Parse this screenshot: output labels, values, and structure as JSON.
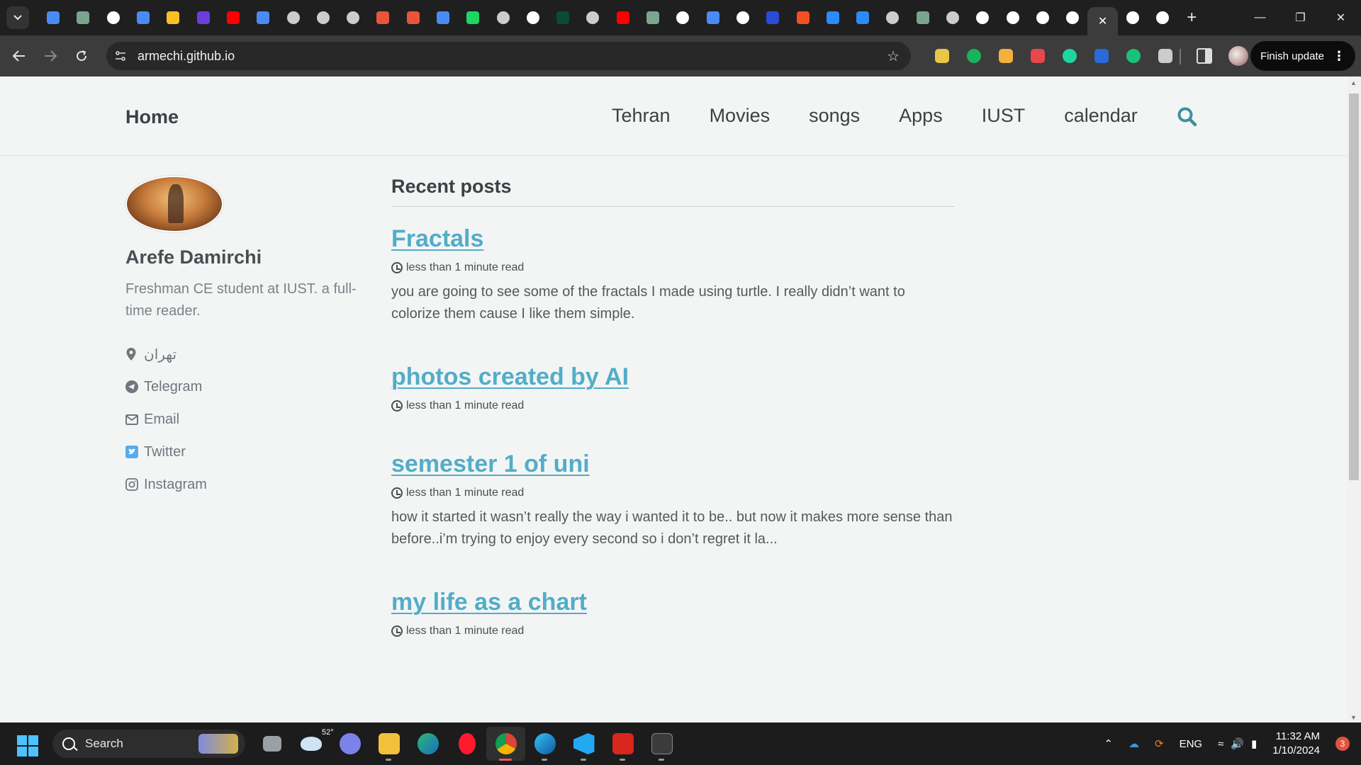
{
  "browser": {
    "tabs": [
      {
        "icon": "dropdown-icon"
      },
      {
        "icon": "translate-icon",
        "color": "#4a8af4"
      },
      {
        "icon": "chatgpt-icon",
        "color": "#7aa58e"
      },
      {
        "icon": "github-icon",
        "color": "#ffffff"
      },
      {
        "icon": "app-icon",
        "color": "#4a8af4"
      },
      {
        "icon": "app-icon",
        "color": "#f6c026"
      },
      {
        "icon": "app-icon",
        "color": "#6a3fd9"
      },
      {
        "icon": "youtube-icon",
        "color": "#ff0000"
      },
      {
        "icon": "calendar-icon",
        "color": "#4a8af4"
      },
      {
        "icon": "globe-icon",
        "color": "#cccccc"
      },
      {
        "icon": "globe-icon",
        "color": "#cccccc"
      },
      {
        "icon": "globe-icon",
        "color": "#cccccc"
      },
      {
        "icon": "pen-icon",
        "color": "#e9553b"
      },
      {
        "icon": "pen-icon",
        "color": "#e9553b"
      },
      {
        "icon": "app-icon",
        "color": "#4a8af4"
      },
      {
        "icon": "spotify-icon",
        "color": "#1ed760"
      },
      {
        "icon": "globe-icon",
        "color": "#cccccc"
      },
      {
        "icon": "notion-icon",
        "color": "#ffffff"
      },
      {
        "icon": "dj-icon",
        "color": "#0c4b33"
      },
      {
        "icon": "globe-icon",
        "color": "#cccccc"
      },
      {
        "icon": "youtube-icon",
        "color": "#ff0000"
      },
      {
        "icon": "chatgpt-icon",
        "color": "#7aa58e"
      },
      {
        "icon": "google-icon",
        "color": "#ffffff"
      },
      {
        "icon": "app-icon",
        "color": "#4a8af4"
      },
      {
        "icon": "mail-icon",
        "color": "#ffffff"
      },
      {
        "icon": "app-icon",
        "color": "#2a4bd6"
      },
      {
        "icon": "microsoft-icon",
        "color": "#f25022"
      },
      {
        "icon": "app-icon",
        "color": "#2a8cf4"
      },
      {
        "icon": "app-icon",
        "color": "#2a8cf4"
      },
      {
        "icon": "globe-icon",
        "color": "#cccccc"
      },
      {
        "icon": "chatgpt-icon",
        "color": "#7aa58e"
      },
      {
        "icon": "globe-icon",
        "color": "#cccccc"
      },
      {
        "icon": "google-icon",
        "color": "#ffffff"
      },
      {
        "icon": "github-icon",
        "color": "#ffffff"
      },
      {
        "icon": "s-icon",
        "color": "#ffffff"
      },
      {
        "icon": "s-icon",
        "color": "#ffffff"
      },
      {
        "icon": "close-icon",
        "active": true
      },
      {
        "icon": "github-icon",
        "color": "#ffffff"
      },
      {
        "icon": "s-icon",
        "color": "#ffffff"
      }
    ],
    "url": "armechi.github.io",
    "finish_update_label": "Finish update",
    "extensions": [
      "#e8c64a",
      "#19b35a",
      "#f2b13c",
      "#e8474d",
      "#1ed7a0",
      "#2a6bd9",
      "#18c27a",
      "#cccccc"
    ]
  },
  "site": {
    "title": "Home",
    "nav": [
      "Tehran",
      "Movies",
      "songs",
      "Apps",
      "IUST",
      "calendar"
    ],
    "accent_color": "#52adc8"
  },
  "author": {
    "name": "Arefe Damirchi",
    "bio": "Freshman CE student at IUST. a full-time reader.",
    "links": [
      {
        "icon": "location-icon",
        "label": "تهران"
      },
      {
        "icon": "telegram-icon",
        "label": "Telegram"
      },
      {
        "icon": "email-icon",
        "label": "Email"
      },
      {
        "icon": "twitter-icon",
        "label": "Twitter"
      },
      {
        "icon": "instagram-icon",
        "label": "Instagram"
      }
    ]
  },
  "main": {
    "section_title": "Recent posts",
    "posts": [
      {
        "title": "Fractals",
        "meta": "less than 1 minute read",
        "excerpt": "you are going to see some of the fractals I made using turtle. I really didn’t want to colorize them cause I like them simple."
      },
      {
        "title": "photos created by AI",
        "meta": "less than 1 minute read",
        "excerpt": ""
      },
      {
        "title": "semester 1 of uni",
        "meta": "less than 1 minute read",
        "excerpt": "how it started it wasn’t really the way i wanted it to be.. but now it makes more sense than before..i’m trying to enjoy every second so i don’t regret it la..."
      },
      {
        "title": "my life as a chart",
        "meta": "less than 1 minute read",
        "excerpt": ""
      }
    ]
  },
  "taskbar": {
    "search_label": "Search",
    "weather_temp": "52°",
    "language": "ENG",
    "time": "11:32 AM",
    "date": "1/10/2024",
    "notification_count": "3"
  }
}
